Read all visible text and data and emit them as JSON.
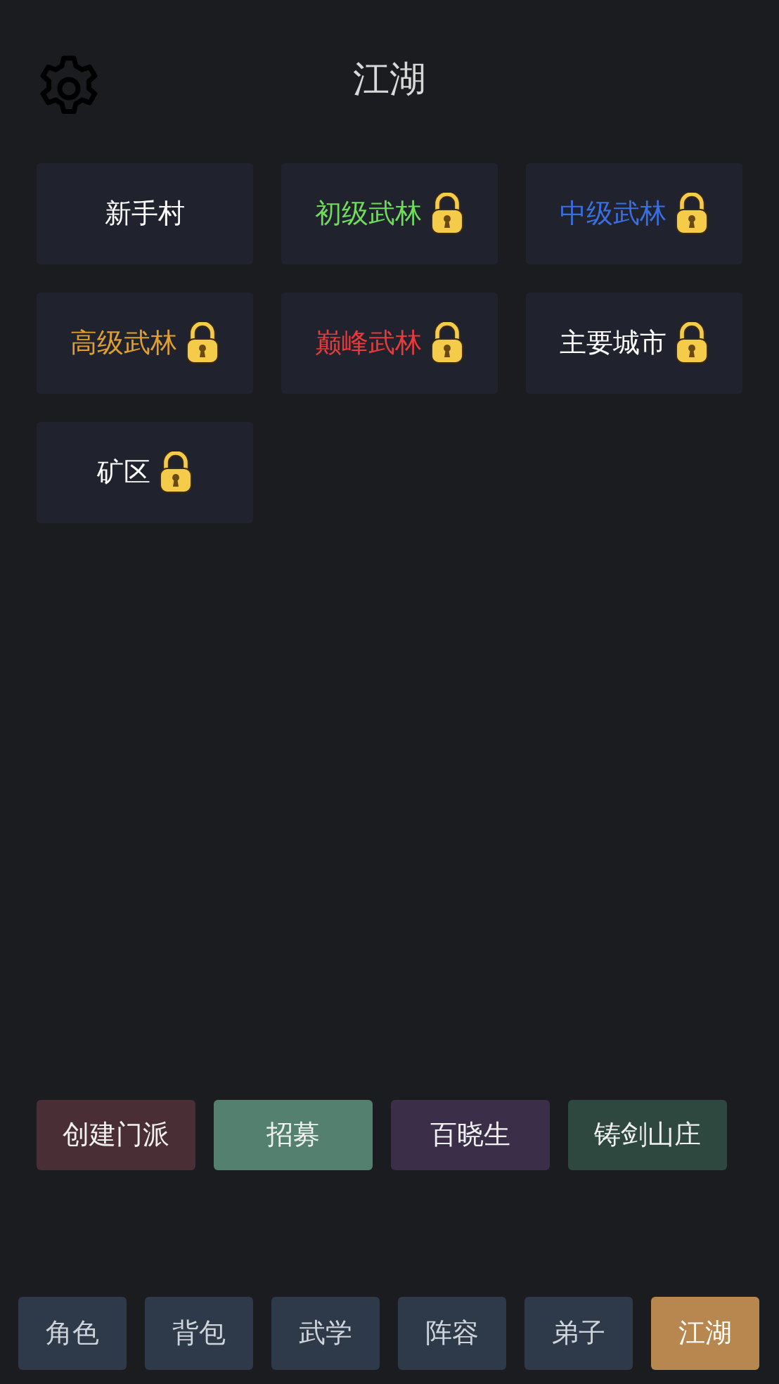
{
  "header": {
    "title": "江湖"
  },
  "areas": [
    {
      "name": "新手村",
      "color": "#ffffff",
      "locked": false
    },
    {
      "name": "初级武林",
      "color": "#6fdc5a",
      "locked": true
    },
    {
      "name": "中级武林",
      "color": "#3a6fe0",
      "locked": true
    },
    {
      "name": "高级武林",
      "color": "#e0a030",
      "locked": true
    },
    {
      "name": "巅峰武林",
      "color": "#e83a3a",
      "locked": true
    },
    {
      "name": "主要城市",
      "color": "#ffffff",
      "locked": true
    },
    {
      "name": "矿区",
      "color": "#ffffff",
      "locked": true
    }
  ],
  "actions": [
    {
      "label": "创建门派",
      "color": "#4a2e35"
    },
    {
      "label": "招募",
      "color": "#548070"
    },
    {
      "label": "百晓生",
      "color": "#3a2e48"
    },
    {
      "label": "铸剑山庄",
      "color": "#2e4840"
    }
  ],
  "nav": [
    {
      "label": "角色",
      "selected": false
    },
    {
      "label": "背包",
      "selected": false
    },
    {
      "label": "武学",
      "selected": false
    },
    {
      "label": "阵容",
      "selected": false
    },
    {
      "label": "弟子",
      "selected": false
    },
    {
      "label": "江湖",
      "selected": true
    }
  ]
}
